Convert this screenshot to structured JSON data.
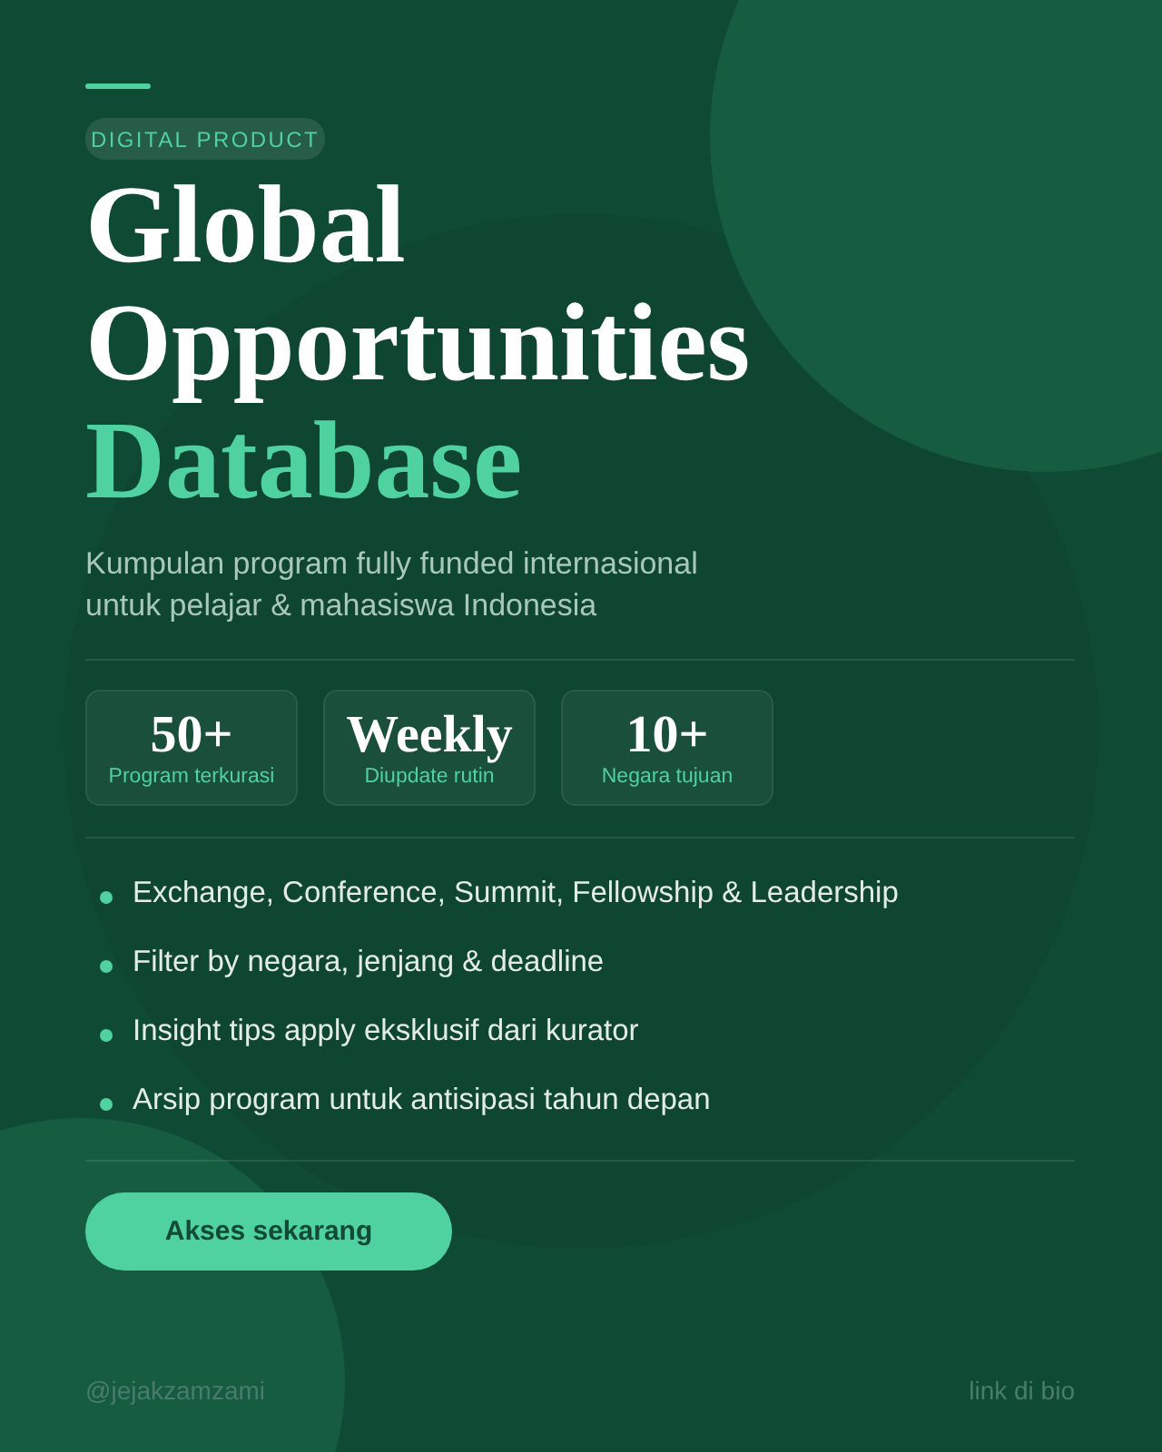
{
  "tag": "DIGITAL PRODUCT",
  "title_lines": [
    {
      "text": "Global",
      "accent": false
    },
    {
      "text": "Opportunities",
      "accent": false
    },
    {
      "text": "Database",
      "accent": true
    }
  ],
  "subtitle": "Kumpulan program fully funded internasional untuk pelajar & mahasiswa Indonesia",
  "stats": [
    {
      "value": "50+",
      "label": "Program terkurasi"
    },
    {
      "value": "Weekly",
      "label": "Diupdate rutin"
    },
    {
      "value": "10+",
      "label": "Negara tujuan"
    }
  ],
  "features": [
    "Exchange, Conference, Summit, Fellowship & Leadership",
    "Filter by negara, jenjang & deadline",
    "Insight tips apply eksklusif dari kurator",
    "Arsip program untuk antisipasi tahun depan"
  ],
  "cta": "Akses sekarang",
  "footer": {
    "handle": "@jejakzamzami",
    "link": "link di bio"
  }
}
